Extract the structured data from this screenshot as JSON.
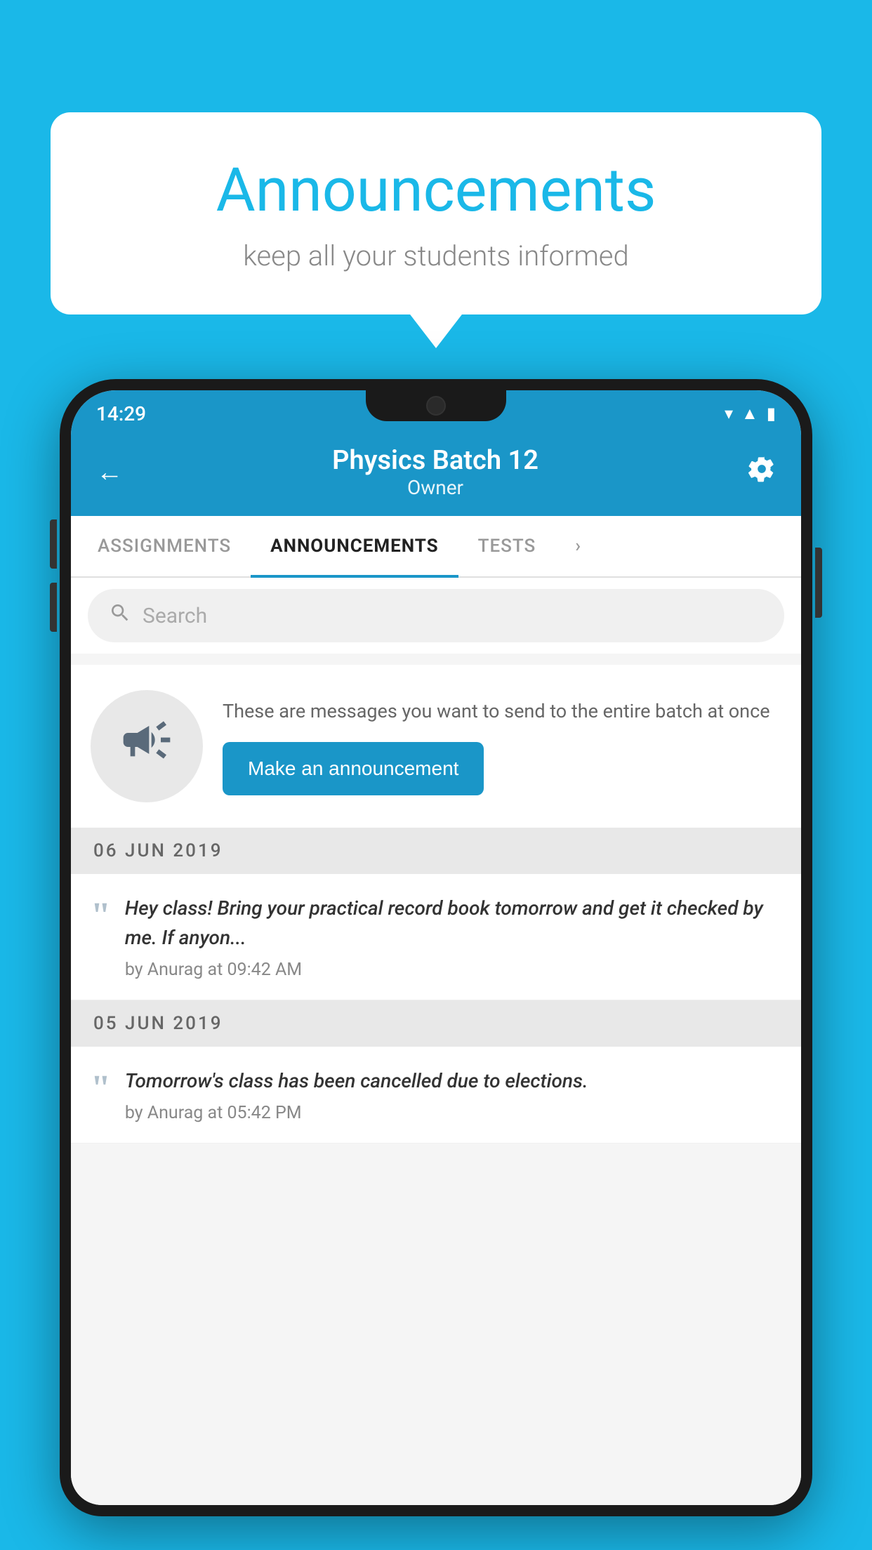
{
  "bubble": {
    "title": "Announcements",
    "subtitle": "keep all your students informed"
  },
  "phone": {
    "statusBar": {
      "time": "14:29"
    },
    "header": {
      "title": "Physics Batch 12",
      "subtitle": "Owner",
      "backLabel": "←",
      "settingsLabel": "⚙"
    },
    "tabs": [
      {
        "label": "ASSIGNMENTS",
        "active": false
      },
      {
        "label": "ANNOUNCEMENTS",
        "active": true
      },
      {
        "label": "TESTS",
        "active": false
      },
      {
        "label": "...",
        "active": false
      }
    ],
    "search": {
      "placeholder": "Search"
    },
    "emptyCard": {
      "description": "These are messages you want to send to the entire batch at once",
      "buttonLabel": "Make an announcement"
    },
    "announcements": [
      {
        "date": "06  JUN  2019",
        "entries": [
          {
            "text": "Hey class! Bring your practical record book tomorrow and get it checked by me. If anyon...",
            "author": "by Anurag at 09:42 AM"
          }
        ]
      },
      {
        "date": "05  JUN  2019",
        "entries": [
          {
            "text": "Tomorrow's class has been cancelled due to elections.",
            "author": "by Anurag at 05:42 PM"
          }
        ]
      }
    ]
  }
}
